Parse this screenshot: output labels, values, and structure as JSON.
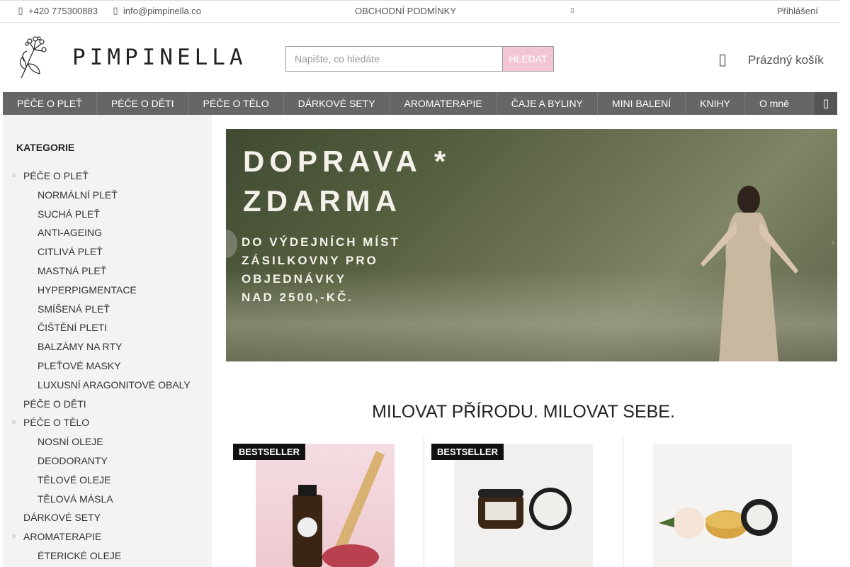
{
  "topbar": {
    "phone": "+420 775300883",
    "email": "info@pimpinella.co",
    "terms": "OBCHODNÍ PODMÍNKY",
    "login": "Přihlášení"
  },
  "header": {
    "brand": "PIMPINELLA",
    "search_placeholder": "Napište, co hledáte",
    "search_button": "HLEDAT",
    "cart_label": "Prázdný košík"
  },
  "nav": {
    "items": [
      "PÉČE O PLEŤ",
      "PÉČE O DĚTI",
      "PÉČE O TĚLO",
      "DÁRKOVÉ SETY",
      "AROMATERAPIE",
      "ČAJE A BYLINY",
      "MINI BALENÍ",
      "KNIHY",
      "O mně"
    ]
  },
  "sidebar": {
    "title": "KATEGORIE",
    "items": [
      {
        "label": "PÉČE O PLEŤ",
        "level": 1
      },
      {
        "label": "NORMÁLNÍ PLEŤ",
        "level": 2
      },
      {
        "label": "SUCHÁ PLEŤ",
        "level": 2
      },
      {
        "label": "ANTI-AGEING",
        "level": 2
      },
      {
        "label": "CITLIVÁ PLEŤ",
        "level": 2
      },
      {
        "label": "MASTNÁ PLEŤ",
        "level": 2
      },
      {
        "label": "HYPERPIGMENTACE",
        "level": 2
      },
      {
        "label": "SMÍŠENÁ PLEŤ",
        "level": 2
      },
      {
        "label": "ČIŠTĚNÍ PLETI",
        "level": 2
      },
      {
        "label": "BALZÁMY NA RTY",
        "level": 2
      },
      {
        "label": "PLEŤOVÉ MASKY",
        "level": 2
      },
      {
        "label": "LUXUSNÍ ARAGONITOVÉ OBALY",
        "level": 2
      },
      {
        "label": "PÉČE O DĚTI",
        "level": 1
      },
      {
        "label": "PÉČE O TĚLO",
        "level": 1
      },
      {
        "label": "NOSNÍ OLEJE",
        "level": 2
      },
      {
        "label": "DEODORANTY",
        "level": 2
      },
      {
        "label": "TĚLOVÉ OLEJE",
        "level": 2
      },
      {
        "label": "TĚLOVÁ MÁSLA",
        "level": 2
      },
      {
        "label": "DÁRKOVÉ SETY",
        "level": 1
      },
      {
        "label": "AROMATERAPIE",
        "level": 1
      },
      {
        "label": "ÉTERICKÉ OLEJE",
        "level": 2
      }
    ]
  },
  "banner": {
    "line1": "DOPRAVA *",
    "line2": "ZDARMA",
    "line3": "DO VÝDEJNÍCH MÍST",
    "line4": "ZÁSILKOVNY PRO",
    "line5": "OBJEDNÁVKY",
    "line6": "NAD 2500,-KČ."
  },
  "main": {
    "tagline": "MILOVAT PŘÍRODU. MILOVAT SEBE."
  },
  "products": [
    {
      "badge": "BESTSELLER"
    },
    {
      "badge": "BESTSELLER"
    },
    {
      "badge": ""
    }
  ],
  "colors": {
    "nav_bg": "#666666",
    "sidebar_bg": "#f3f3f3",
    "search_button_bg": "#f2c6d4",
    "badge_bg": "#111111"
  },
  "icons": {
    "phone": "phone-icon",
    "email": "mail-icon",
    "cart": "cart-icon",
    "nav_end": "search-icon"
  }
}
